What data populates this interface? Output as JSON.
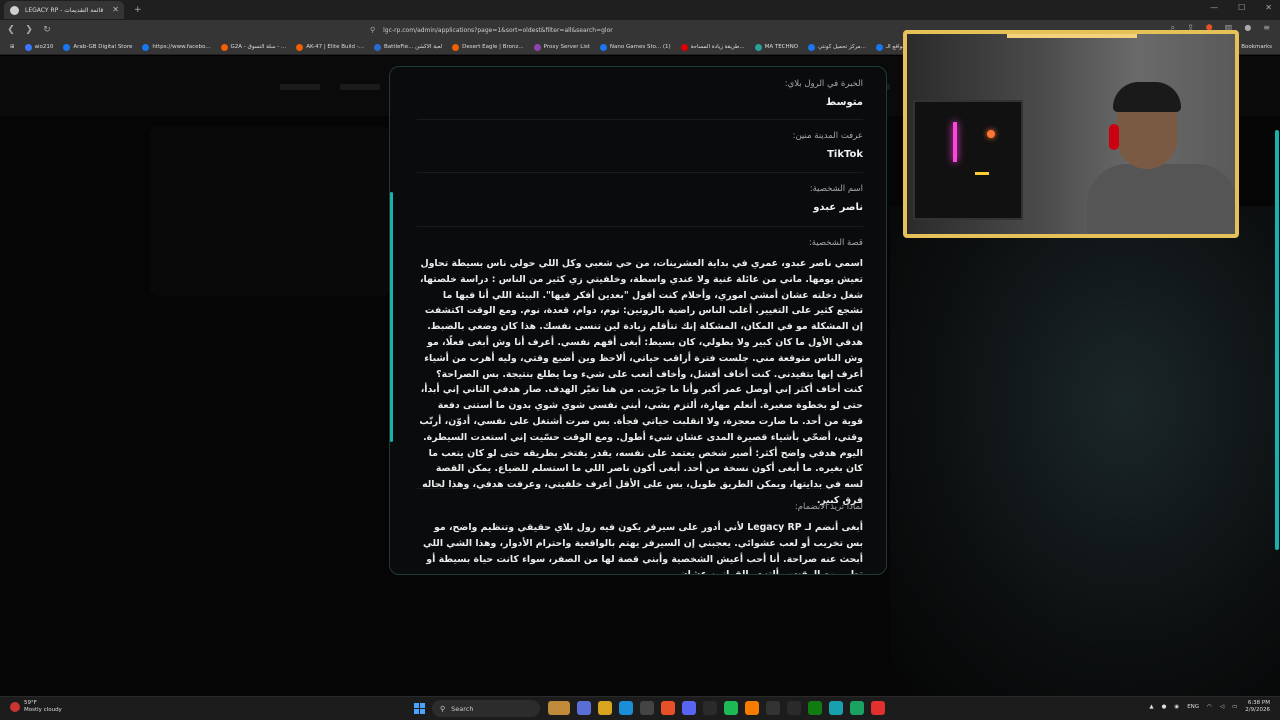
{
  "browser": {
    "tab_title": "LEGACY RP - قائمة التقديمات",
    "url": "lgc-rp.com/admin/applications?page=1&sort=oldest&filter=all&search=glor",
    "bookmarks": [
      {
        "label": "aio210",
        "color": "#3a78ff"
      },
      {
        "label": "Arab-GB Digital Store",
        "color": "#1877f2"
      },
      {
        "label": "https://www.facebo...",
        "color": "#1877f2"
      },
      {
        "label": "G2A - سلة التسوق - ...",
        "color": "#f05f00"
      },
      {
        "label": "AK-47 | Elite Build -...",
        "color": "#f05f00"
      },
      {
        "label": "BattleFie... لعبة الاكشن",
        "color": "#2a6ad1"
      },
      {
        "label": "Desert Eagle | Bronz...",
        "color": "#f05f00"
      },
      {
        "label": "Proxy Server List",
        "color": "#8e44ad"
      },
      {
        "label": "Nano Games Sto... (1)",
        "color": "#1877f2"
      },
      {
        "label": "طريقة زيادة المساحة...",
        "color": "#e00000"
      },
      {
        "label": "MA TECHNO",
        "color": "#2aa198"
      },
      {
        "label": "مركز تحميل كونتي...",
        "color": "#1877f2"
      },
      {
        "label": "مواقع الـ...",
        "color": "#1877f2"
      }
    ],
    "all_bookmarks": "All Bookmarks"
  },
  "modal": {
    "fields": [
      {
        "label": "الخبرة في الرول بلاي:",
        "value": "متوسط"
      },
      {
        "label": "عرفت المدينة منين:",
        "value": "TikTok"
      },
      {
        "label": "اسم الشخصية:",
        "value": "ناصر عبدو"
      }
    ],
    "story": {
      "label": "قصة الشخصية:",
      "text": "اسمي ناصر عبدو، عمري في بداية العشرينات، من حي شعبي وكل اللي حولي ناس بسيطة تحاول تعيش يومها. ماني من عائلة غنية ولا عندي واسطة، وخلفيتي زي كثير من الناس : دراسة خلصتها، شغل دخلته عشان أمشي اموري، وأحلام كنت أقول \"بعدين أفكر فيها\". البيئة اللي أنا فيها ما تشجع كثير على التغيير. أغلب الناس راضية بالروتين: نوم، دوام، قعدة، نوم. ومع الوقت اكتشفت إن المشكلة مو في المكان، المشكلة إنك تتأقلم زيادة لين تنسى نفسك. هذا كان وضعي بالضبط. هدفي الأول ما كان كبير ولا بطولي، كان بسيط: أبغى أفهم نفسي. أعرف أنا وش أبغى فعلًا، مو وش الناس متوقعة مني. جلست فترة أراقب حياتي، ألاحظ وين أضيع وقتي، وليه أهرب من أشياء أعرف إنها بتفيدني. كنت أخاف أفشل، وأخاف أتعب على شيء وما يطلع بنتيجة. بس الصراحة؟ كنت أخاف أكثر إني أوصل عمر أكبر وأنا ما جرّبت. من هنا تغيّر الهدف. صار هدفي الثاني إني أبدأ، حتى لو بخطوة صغيرة. أتعلم مهارة، ألتزم بشي، أبني نفسي شوي شوي بدون ما أستنى دفعة قوية من أحد. ما صارت معجزة، ولا انقلبت حياتي فجأة. بس صرت أشتغل على نفسي، أدوّن، أرتّب وقتي، أضحّي بأشياء قصيرة المدى عشان شيء أطول. ومع الوقت حسّيت إني استعدت السيطرة. اليوم هدفي واضح أكثر: أصير شخص يعتمد على نفسه، يقدر يفتخر بطريقه حتى لو كان يتعب ما كان بغيره. ما أبغى أكون نسخة من أحد. أبغى أكون ناصر اللي ما استسلم للضياع. يمكن القصة لسه في بدايتها، ويمكن الطريق طويل، بس على الأقل أعرف خلفيتي، وعرفت هدفي، وهذا لحاله فرق كبير."
    },
    "why_join": {
      "label": "لماذا تريد الانضمام:",
      "text": "أبغى أنضم لـ Legacy RP لأني أدور على سيرفر يكون فيه رول بلاي حقيقي وتنظيم واضح، مو بس تخريب أو لعب عشوائي. يعجبني إن السيرفر يهتم بالواقعية واحترام الأدوار، وهذا الشي اللي أبحث عنه صراحة. أنا أحب أعيش الشخصية وأبني قصة لها من الصفر، سواء كانت حياة بسيطة أو تطور مع الوقت، وألتزم بالقوانين عشان"
    }
  },
  "taskbar": {
    "temperature": "59°F",
    "weather": "Mostly cloudy",
    "search_placeholder": "Search",
    "lang": "ENG",
    "time": "6:38 PM",
    "date": "2/9/2026"
  },
  "accent_color": "#1ab0ad"
}
